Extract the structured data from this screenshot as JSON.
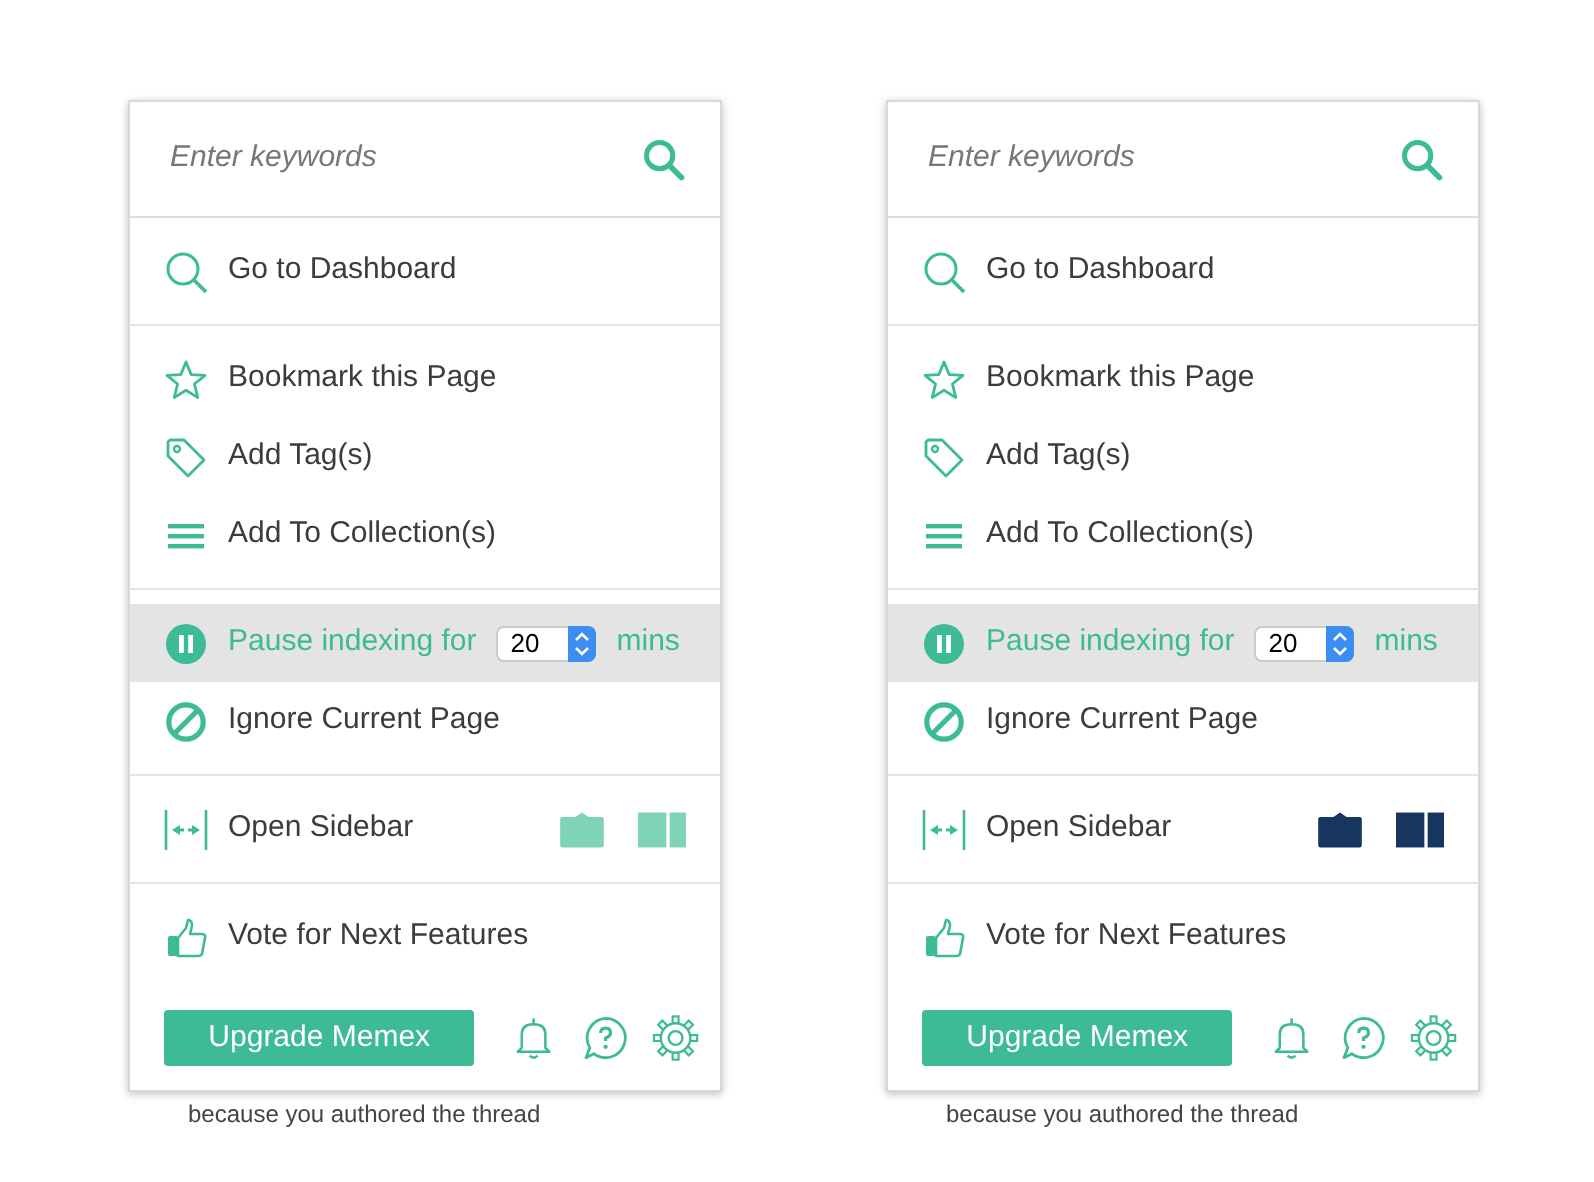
{
  "panels": [
    {
      "search": {
        "placeholder": "Enter keywords"
      },
      "sections": [
        [
          {
            "kind": "dashboard",
            "label": "Go to Dashboard",
            "highlighted": false
          }
        ],
        [
          {
            "kind": "bookmark",
            "label": "Bookmark this Page",
            "highlighted": false
          },
          {
            "kind": "tag",
            "label": "Add Tag(s)",
            "highlighted": false
          },
          {
            "kind": "collection",
            "label": "Add To Collection(s)",
            "highlighted": false
          }
        ],
        [
          {
            "kind": "pause",
            "label": "Pause indexing for",
            "minutes": "20",
            "unit": "mins",
            "highlighted": true
          },
          {
            "kind": "ignore",
            "label": "Ignore Current Page",
            "highlighted": false
          }
        ],
        [
          {
            "kind": "sidebar",
            "label": "Open Sidebar",
            "highlighted": false
          }
        ],
        [
          {
            "kind": "vote",
            "label": "Vote for Next Features",
            "highlighted": false
          }
        ]
      ],
      "color": "#7fd3b8",
      "upgrade_button": "Upgrade Memex",
      "background_text": "because you authored the thread"
    },
    {
      "search": {
        "placeholder": "Enter keywords"
      },
      "sections": [
        [
          {
            "kind": "dashboard",
            "label": "Go to Dashboard",
            "highlighted": false
          }
        ],
        [
          {
            "kind": "bookmark",
            "label": "Bookmark this Page",
            "highlighted": false
          },
          {
            "kind": "tag",
            "label": "Add Tag(s)",
            "highlighted": false
          },
          {
            "kind": "collection",
            "label": "Add To Collection(s)",
            "highlighted": false
          }
        ],
        [
          {
            "kind": "pause",
            "label": "Pause indexing for",
            "minutes": "20",
            "unit": "mins",
            "highlighted": true
          },
          {
            "kind": "ignore",
            "label": "Ignore Current Page",
            "highlighted": false
          }
        ],
        [
          {
            "kind": "sidebar",
            "label": "Open Sidebar",
            "highlighted": false
          }
        ],
        [
          {
            "kind": "vote",
            "label": "Vote for Next Features",
            "highlighted": false
          }
        ]
      ],
      "color": "#17365f",
      "upgrade_button": "Upgrade Memex",
      "background_text": "because you authored the thread"
    }
  ]
}
